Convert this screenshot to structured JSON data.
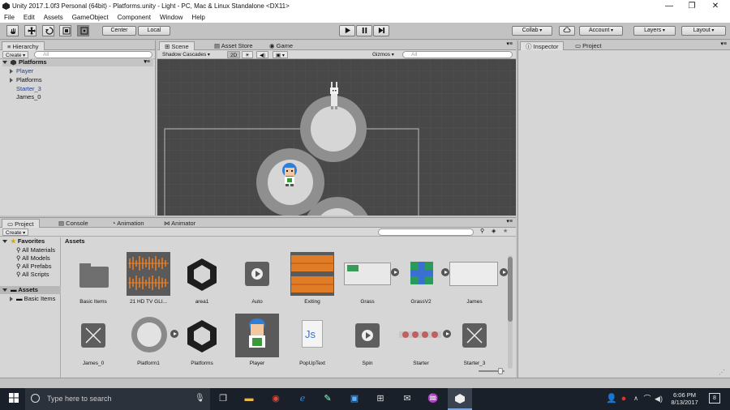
{
  "window": {
    "title": "Unity 2017.1.0f3 Personal (64bit) - Platforms.unity - Light - PC, Mac & Linux Standalone <DX11>",
    "minimize": "—",
    "maximize": "❐",
    "close": "✕"
  },
  "menu": [
    "File",
    "Edit",
    "Assets",
    "GameObject",
    "Component",
    "Window",
    "Help"
  ],
  "toolbar": {
    "center": "Center",
    "local": "Local",
    "collab": "Collab",
    "account": "Account",
    "layers": "Layers",
    "layout": "Layout"
  },
  "hierarchy": {
    "tab": "Hierarchy",
    "create": "Create",
    "search_placeholder": "All",
    "scene": "Platforms",
    "items": [
      {
        "label": "Player",
        "expandable": true,
        "color": "#2040a0"
      },
      {
        "label": "Platforms",
        "expandable": true,
        "color": "#111"
      },
      {
        "label": "Starter_3",
        "expandable": false,
        "color": "#2040a0"
      },
      {
        "label": "James_0",
        "expandable": false,
        "color": "#111"
      }
    ]
  },
  "scene": {
    "tabs": [
      "Scene",
      "Asset Store",
      "Game"
    ],
    "shading": "Shadow Cascades",
    "mode2d": "2D",
    "gizmos": "Gizmos",
    "search_placeholder": "All"
  },
  "inspector": {
    "tabs": [
      "Inspector",
      "Project"
    ]
  },
  "project": {
    "tabs": [
      "Project",
      "Console",
      "Animation",
      "Animator"
    ],
    "create": "Create",
    "favorites": "Favorites",
    "fav_items": [
      "All Materials",
      "All Models",
      "All Prefabs",
      "All Scripts"
    ],
    "assets_root": "Assets",
    "assets_children": [
      "Basic Items"
    ],
    "breadcrumb": "Assets",
    "row1": [
      "Basic Items",
      "21 HD TV GLI...",
      "area1",
      "Auto",
      "Exiting",
      "Grass",
      "GrassV2",
      "James"
    ],
    "row2": [
      "James_0",
      "Platform1",
      "Platforms",
      "Player",
      "PopUpText",
      "Spin",
      "Starter",
      "Starter_3"
    ]
  },
  "taskbar": {
    "search_placeholder": "Type here to search",
    "time": "6:06 PM",
    "date": "8/13/2017",
    "notifications": "8"
  },
  "colors": {
    "scene_bg": "#484848",
    "accent": "#3a72c4"
  }
}
